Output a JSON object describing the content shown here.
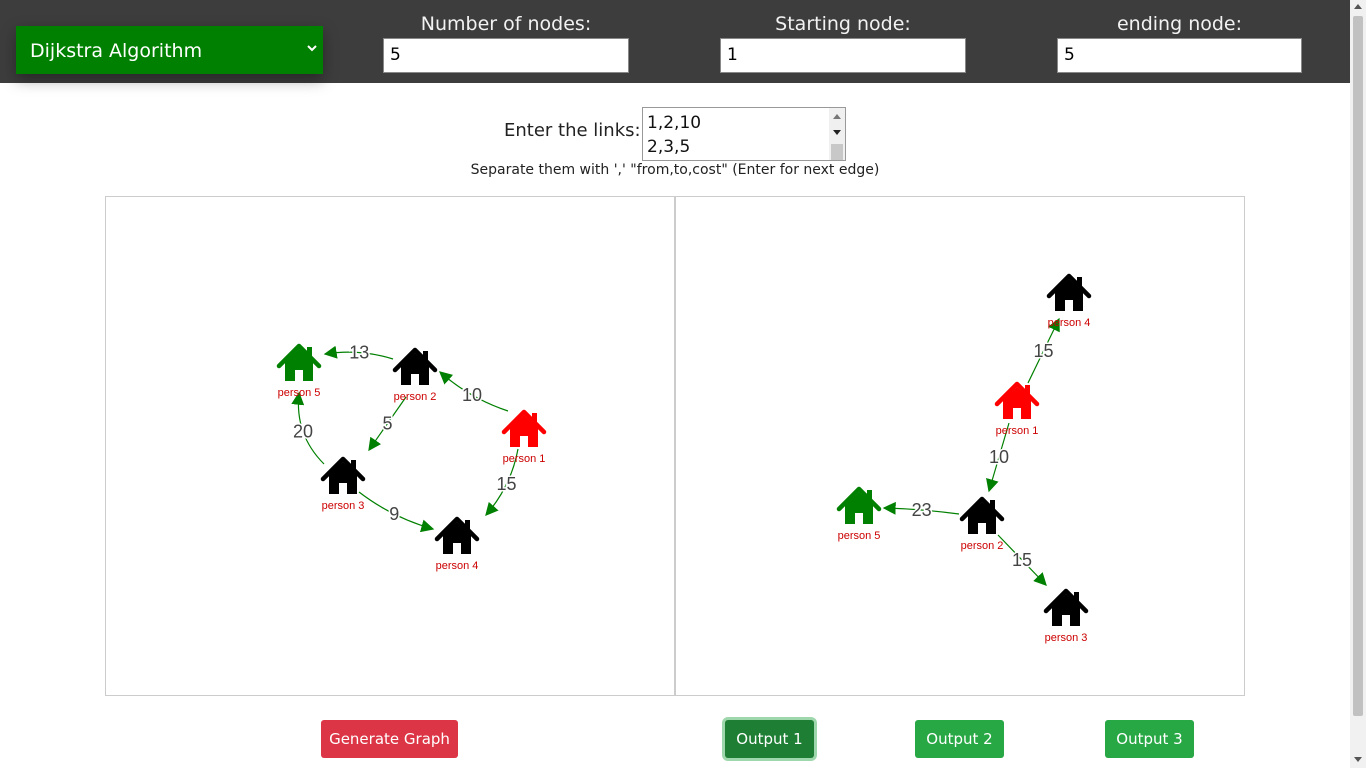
{
  "algorithm_select": {
    "value": "Dijkstra Algorithm"
  },
  "fields": {
    "nodes": {
      "label": "Number of nodes:",
      "value": "5"
    },
    "start": {
      "label": "Starting node:",
      "value": "1"
    },
    "end": {
      "label": "ending node:",
      "value": "5"
    }
  },
  "links": {
    "label": "Enter the links:",
    "lines": [
      "1,2,10",
      "2,3,5"
    ],
    "hint": "Separate them with ',' \"from,to,cost\" (Enter for next edge)"
  },
  "colors": {
    "start": "#ff0000",
    "end": "#008000",
    "normal": "#000000",
    "edge": "#008000",
    "label": "#cc0000"
  },
  "graph": {
    "nodes": [
      {
        "id": 1,
        "label": "person 1",
        "role": "start"
      },
      {
        "id": 2,
        "label": "person 2",
        "role": "normal"
      },
      {
        "id": 3,
        "label": "person 3",
        "role": "normal"
      },
      {
        "id": 4,
        "label": "person 4",
        "role": "normal"
      },
      {
        "id": 5,
        "label": "person 5",
        "role": "end"
      }
    ],
    "edges": [
      {
        "from": 1,
        "to": 2,
        "cost": "10"
      },
      {
        "from": 2,
        "to": 3,
        "cost": "5"
      },
      {
        "from": 3,
        "to": 4,
        "cost": "9"
      },
      {
        "from": 1,
        "to": 4,
        "cost": "15"
      },
      {
        "from": 3,
        "to": 5,
        "cost": "20"
      },
      {
        "from": 2,
        "to": 5,
        "cost": "13"
      }
    ]
  },
  "output": {
    "nodes": [
      {
        "id": 4,
        "label": "person 4",
        "role": "normal"
      },
      {
        "id": 1,
        "label": "person 1",
        "role": "start"
      },
      {
        "id": 2,
        "label": "person 2",
        "role": "normal"
      },
      {
        "id": 5,
        "label": "person 5",
        "role": "end"
      },
      {
        "id": 3,
        "label": "person 3",
        "role": "normal"
      }
    ],
    "edges": [
      {
        "from": 1,
        "to": 4,
        "cost": "15"
      },
      {
        "from": 1,
        "to": 2,
        "cost": "10"
      },
      {
        "from": 2,
        "to": 5,
        "cost": "23"
      },
      {
        "from": 2,
        "to": 3,
        "cost": "15"
      }
    ]
  },
  "buttons": {
    "generate": "Generate Graph",
    "output1": "Output 1",
    "output2": "Output 2",
    "output3": "Output 3"
  }
}
